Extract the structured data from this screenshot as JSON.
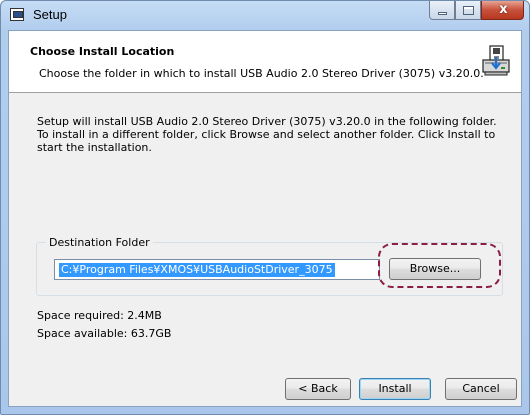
{
  "window": {
    "title": "Setup",
    "close_glyph": "x"
  },
  "header": {
    "title": "Choose Install Location",
    "subtitle": "Choose the folder in which to install USB Audio 2.0 Stereo Driver (3075) v3.20.0.",
    "icon": "installer-icon"
  },
  "body": {
    "description": "Setup will install USB Audio 2.0 Stereo Driver (3075) v3.20.0 in the following folder. To install in a different folder, click Browse and select another folder. Click Install to start the installation."
  },
  "destination": {
    "legend": "Destination Folder",
    "path": "C:¥Program Files¥XMOS¥USBAudioStDriver_3075",
    "browse_label": "Browse..."
  },
  "space": {
    "required": "Space required: 2.4MB",
    "available": "Space available: 63.7GB"
  },
  "footer": {
    "back_label": "< Back",
    "install_label": "Install",
    "cancel_label": "Cancel"
  },
  "colors": {
    "highlight": "#8a1e45",
    "selection": "#3399ff"
  }
}
